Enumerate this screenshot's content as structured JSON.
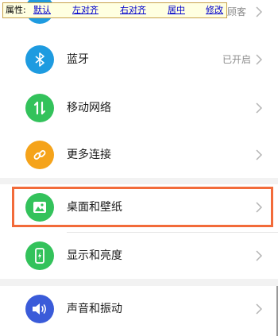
{
  "toolbar": {
    "label": "属性:",
    "links": [
      "默认",
      "左对齐",
      "右对齐",
      "居中",
      "修改"
    ]
  },
  "top_row": {
    "value_partial": "-顾客"
  },
  "settings": [
    {
      "label": "蓝牙",
      "value": "已开启",
      "icon": "bluetooth-icon",
      "color": "#1e9be0"
    },
    {
      "label": "移动网络",
      "value": "",
      "icon": "mobile-network-icon",
      "color": "#33c25b"
    },
    {
      "label": "更多连接",
      "value": "",
      "icon": "link-icon",
      "color": "#f5a31a"
    },
    {
      "label": "桌面和壁纸",
      "value": "",
      "icon": "wallpaper-icon",
      "color": "#33c25b"
    },
    {
      "label": "显示和亮度",
      "value": "",
      "icon": "display-brightness-icon",
      "color": "#33c25b"
    },
    {
      "label": "声音和振动",
      "value": "",
      "icon": "sound-icon",
      "color": "#3a5bd9"
    }
  ],
  "colors": {
    "highlight": "#f26b3a",
    "blue_icon": "#1e9be0",
    "green_icon": "#33c25b",
    "orange_icon": "#f5a31a",
    "indigo_icon": "#3a5bd9"
  }
}
